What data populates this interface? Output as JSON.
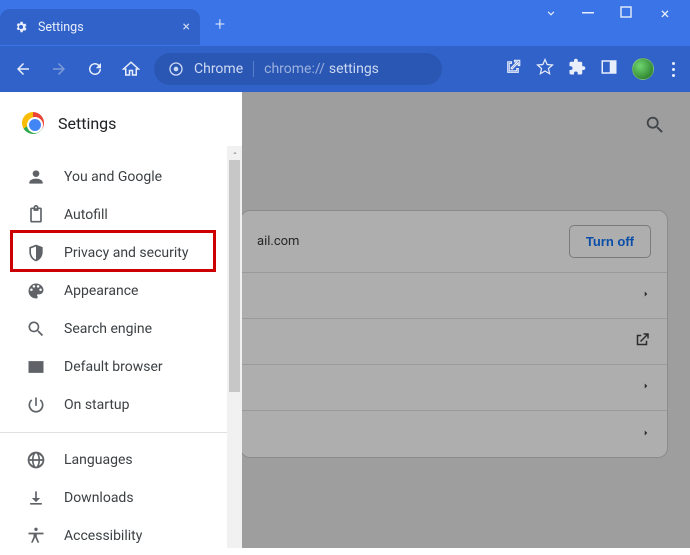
{
  "window": {
    "tabTitle": "Settings",
    "url_prefix": "Chrome",
    "url_label": "chrome://",
    "url_path": "settings"
  },
  "sidebar": {
    "title": "Settings",
    "items": [
      {
        "label": "You and Google"
      },
      {
        "label": "Autofill"
      },
      {
        "label": "Privacy and security"
      },
      {
        "label": "Appearance"
      },
      {
        "label": "Search engine"
      },
      {
        "label": "Default browser"
      },
      {
        "label": "On startup"
      }
    ],
    "secondary": [
      {
        "label": "Languages"
      },
      {
        "label": "Downloads"
      },
      {
        "label": "Accessibility"
      }
    ]
  },
  "main": {
    "account_fragment": "ail.com",
    "turn_off_label": "Turn off"
  }
}
